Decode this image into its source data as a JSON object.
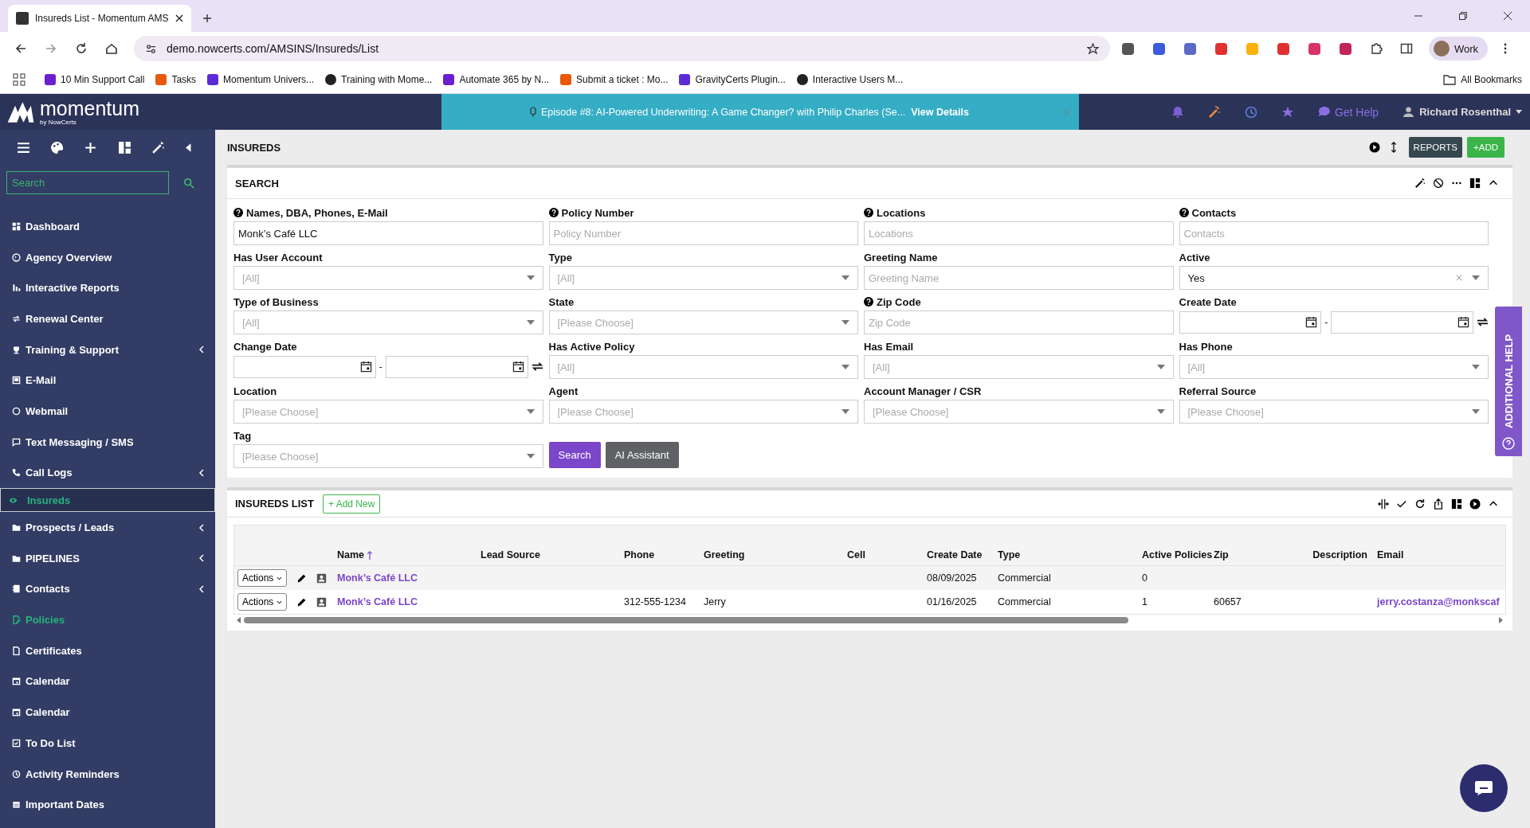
{
  "browser": {
    "tab_title": "Insureds List - Momentum AMS",
    "url": "demo.nowcerts.com/AMSINS/Insureds/List",
    "profile": "Work",
    "bookmarks": [
      "10 Min Support Call",
      "Tasks",
      "Momentum Univers...",
      "Training with Mome...",
      "Automate 365 by N...",
      "Submit a ticket : Mo...",
      "GravityCerts Plugin...",
      "Interactive Users M..."
    ],
    "all_bookmarks": "All Bookmarks"
  },
  "header": {
    "logo": "momentum",
    "logo_sub": "by NowCerts",
    "banner_text": "Episode #8: AI-Powered Underwriting: A Game Changer? with Philip Charles (Se...",
    "banner_link": "View Details",
    "help": "Get Help",
    "user": "Richard Rosenthal"
  },
  "sidebar": {
    "search_placeholder": "Search",
    "items": [
      {
        "label": "Dashboard",
        "selected": false,
        "accent": false,
        "expandable": false
      },
      {
        "label": "Agency Overview",
        "selected": false,
        "accent": false,
        "expandable": false
      },
      {
        "label": "Interactive Reports",
        "selected": false,
        "accent": false,
        "expandable": false
      },
      {
        "label": "Renewal Center",
        "selected": false,
        "accent": false,
        "expandable": false
      },
      {
        "label": "Training & Support",
        "selected": false,
        "accent": false,
        "expandable": true
      },
      {
        "label": "E-Mail",
        "selected": false,
        "accent": false,
        "expandable": false
      },
      {
        "label": "Webmail",
        "selected": false,
        "accent": false,
        "expandable": false
      },
      {
        "label": "Text Messaging / SMS",
        "selected": false,
        "accent": false,
        "expandable": false
      },
      {
        "label": "Call Logs",
        "selected": false,
        "accent": false,
        "expandable": true
      },
      {
        "label": "Insureds",
        "selected": true,
        "accent": true,
        "expandable": false
      },
      {
        "label": "Prospects / Leads",
        "selected": false,
        "accent": false,
        "expandable": true
      },
      {
        "label": "PIPELINES",
        "selected": false,
        "accent": false,
        "expandable": true
      },
      {
        "label": "Contacts",
        "selected": false,
        "accent": false,
        "expandable": true
      },
      {
        "label": "Policies",
        "selected": false,
        "accent": true,
        "expandable": false
      },
      {
        "label": "Certificates",
        "selected": false,
        "accent": false,
        "expandable": false
      },
      {
        "label": "Calendar",
        "selected": false,
        "accent": false,
        "expandable": false
      },
      {
        "label": "Calendar",
        "selected": false,
        "accent": false,
        "expandable": false
      },
      {
        "label": "To Do List",
        "selected": false,
        "accent": false,
        "expandable": false
      },
      {
        "label": "Activity Reminders",
        "selected": false,
        "accent": false,
        "expandable": false
      },
      {
        "label": "Important Dates",
        "selected": false,
        "accent": false,
        "expandable": false
      }
    ]
  },
  "page": {
    "title": "INSUREDS",
    "reports": "REPORTS",
    "add": "+ADD"
  },
  "search": {
    "title": "SEARCH",
    "search_button": "Search",
    "ai_button": "AI Assistant",
    "fields": [
      {
        "kind": "text",
        "label": "Names, DBA, Phones, E-Mail",
        "help": true,
        "value": "Monk’s Café LLC"
      },
      {
        "kind": "text",
        "label": "Policy Number",
        "help": true,
        "placeholder": "Policy Number"
      },
      {
        "kind": "text",
        "label": "Locations",
        "help": true,
        "placeholder": "Locations"
      },
      {
        "kind": "text",
        "label": "Contacts",
        "help": true,
        "placeholder": "Contacts"
      },
      {
        "kind": "select",
        "label": "Has User Account",
        "help": false,
        "placeholder": "[All]",
        "clearable": false
      },
      {
        "kind": "select",
        "label": "Type",
        "help": false,
        "placeholder": "[All]",
        "clearable": false
      },
      {
        "kind": "text",
        "label": "Greeting Name",
        "help": false,
        "placeholder": "Greeting Name"
      },
      {
        "kind": "select",
        "label": "Active",
        "help": false,
        "value": "Yes",
        "clearable": true
      },
      {
        "kind": "select",
        "label": "Type of Business",
        "help": false,
        "placeholder": "[All]",
        "clearable": false
      },
      {
        "kind": "select",
        "label": "State",
        "help": false,
        "placeholder": "[Please Choose]",
        "clearable": false
      },
      {
        "kind": "text",
        "label": "Zip Code",
        "help": true,
        "placeholder": "Zip Code"
      },
      {
        "kind": "daterange",
        "label": "Create Date",
        "help": false,
        "separator": "-"
      },
      {
        "kind": "daterange",
        "label": "Change Date",
        "help": false,
        "separator": "-"
      },
      {
        "kind": "select",
        "label": "Has Active Policy",
        "help": false,
        "placeholder": "[All]",
        "clearable": false
      },
      {
        "kind": "select",
        "label": "Has Email",
        "help": false,
        "placeholder": "[All]",
        "clearable": false
      },
      {
        "kind": "select",
        "label": "Has Phone",
        "help": false,
        "placeholder": "[All]",
        "clearable": false
      },
      {
        "kind": "select",
        "label": "Location",
        "help": false,
        "placeholder": "[Please Choose]",
        "clearable": false
      },
      {
        "kind": "select",
        "label": "Agent",
        "help": false,
        "placeholder": "[Please Choose]",
        "clearable": false
      },
      {
        "kind": "select",
        "label": "Account Manager / CSR",
        "help": false,
        "placeholder": "[Please Choose]",
        "clearable": false
      },
      {
        "kind": "select",
        "label": "Referral Source",
        "help": false,
        "placeholder": "[Please Choose]",
        "clearable": false
      },
      {
        "kind": "select",
        "label": "Tag",
        "help": false,
        "placeholder": "[Please Choose]",
        "clearable": false
      }
    ]
  },
  "list": {
    "title": "INSUREDS LIST",
    "add_new": "+ Add New",
    "columns": [
      {
        "label": "Name",
        "sorted": true
      },
      {
        "label": "Lead Source",
        "sorted": false
      },
      {
        "label": "Phone",
        "sorted": false
      },
      {
        "label": "Greeting",
        "sorted": false
      },
      {
        "label": "Cell",
        "sorted": false
      },
      {
        "label": "Create Date",
        "sorted": false
      },
      {
        "label": "Type",
        "sorted": false
      },
      {
        "label": "Active Policies",
        "sorted": false
      },
      {
        "label": "Zip",
        "sorted": false
      },
      {
        "label": "Description",
        "sorted": false
      },
      {
        "label": "Email",
        "sorted": false
      }
    ],
    "rows": [
      {
        "action": "Actions",
        "cells": [
          {
            "text": "Monk’s Café LLC",
            "kind": "link"
          },
          null,
          null,
          null,
          null,
          {
            "text": "08/09/2025",
            "kind": "text"
          },
          {
            "text": "Commercial",
            "kind": "text"
          },
          {
            "text": "0",
            "kind": "text"
          },
          null,
          null,
          null
        ]
      },
      {
        "action": "Actions",
        "cells": [
          {
            "text": "Monk’s Café LLC",
            "kind": "link"
          },
          null,
          {
            "text": "312-555-1234",
            "kind": "text"
          },
          {
            "text": "Jerry",
            "kind": "text"
          },
          null,
          {
            "text": "01/16/2025",
            "kind": "text"
          },
          {
            "text": "Commercial",
            "kind": "text"
          },
          {
            "text": "1",
            "kind": "text"
          },
          {
            "text": "60657",
            "kind": "text"
          },
          null,
          {
            "text": "jerry.costanza@monkscaf",
            "kind": "link"
          }
        ]
      }
    ]
  },
  "help_tab": {
    "label": "ADDITIONAL HELP"
  }
}
